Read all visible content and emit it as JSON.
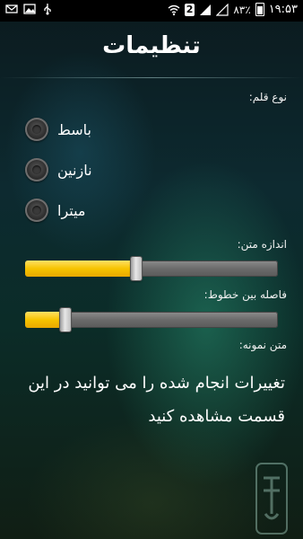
{
  "status_bar": {
    "time": "۱۹:۵۳",
    "battery": "۸۳٪",
    "sim_slot": "2",
    "left_icons": [
      "mail-icon",
      "image-icon",
      "usb-icon"
    ]
  },
  "header": {
    "title": "تنظیمات"
  },
  "font_type": {
    "label": "نوع قلم:",
    "options": [
      {
        "label": "باسط",
        "selected": false
      },
      {
        "label": "نازنین",
        "selected": false
      },
      {
        "label": "میترا",
        "selected": false
      }
    ]
  },
  "text_size": {
    "label": "اندازه متن:",
    "value_fraction": 0.44
  },
  "line_spacing": {
    "label": "فاصله بین خطوط:",
    "value_fraction": 0.16
  },
  "sample_text": {
    "label": "متن نمونه:",
    "text": "تغییرات انجام شده را می توانید در این قسمت مشاهده کنید"
  },
  "colors": {
    "slider_fill": "#f7c300",
    "slider_track": "#6b6b6b"
  }
}
